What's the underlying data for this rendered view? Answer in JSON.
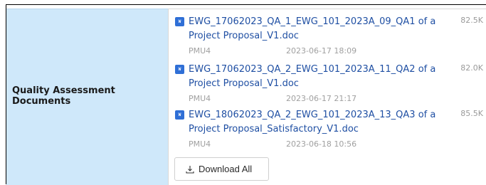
{
  "section": {
    "label": "Quality Assessment Documents"
  },
  "files": [
    {
      "icon": "word-doc-icon",
      "name": "EWG_17062023_QA_1_EWG_101_2023A_09_QA1 of a Project Proposal_V1.doc",
      "size": "82.5K",
      "owner": "PMU4",
      "timestamp": "2023-06-17 18:09"
    },
    {
      "icon": "word-doc-icon",
      "name": "EWG_17062023_QA_2_EWG_101_2023A_11_QA2 of a Project Proposal_V1.doc",
      "size": "82.0K",
      "owner": "PMU4",
      "timestamp": "2023-06-17 21:17"
    },
    {
      "icon": "word-doc-icon",
      "name": "EWG_18062023_QA_2_EWG_101_2023A_13_QA3 of a Project Proposal_Satisfactory_V1.doc",
      "size": "85.5K",
      "owner": "PMU4",
      "timestamp": "2023-06-18 10:56"
    }
  ],
  "actions": {
    "download_all_label": "Download All",
    "download_icon": "download-icon"
  },
  "colors": {
    "label_background": "#cfe8fa",
    "link": "#1f4fa3",
    "meta_text": "#a0a0a0",
    "doc_icon": "#2f6fd6"
  }
}
